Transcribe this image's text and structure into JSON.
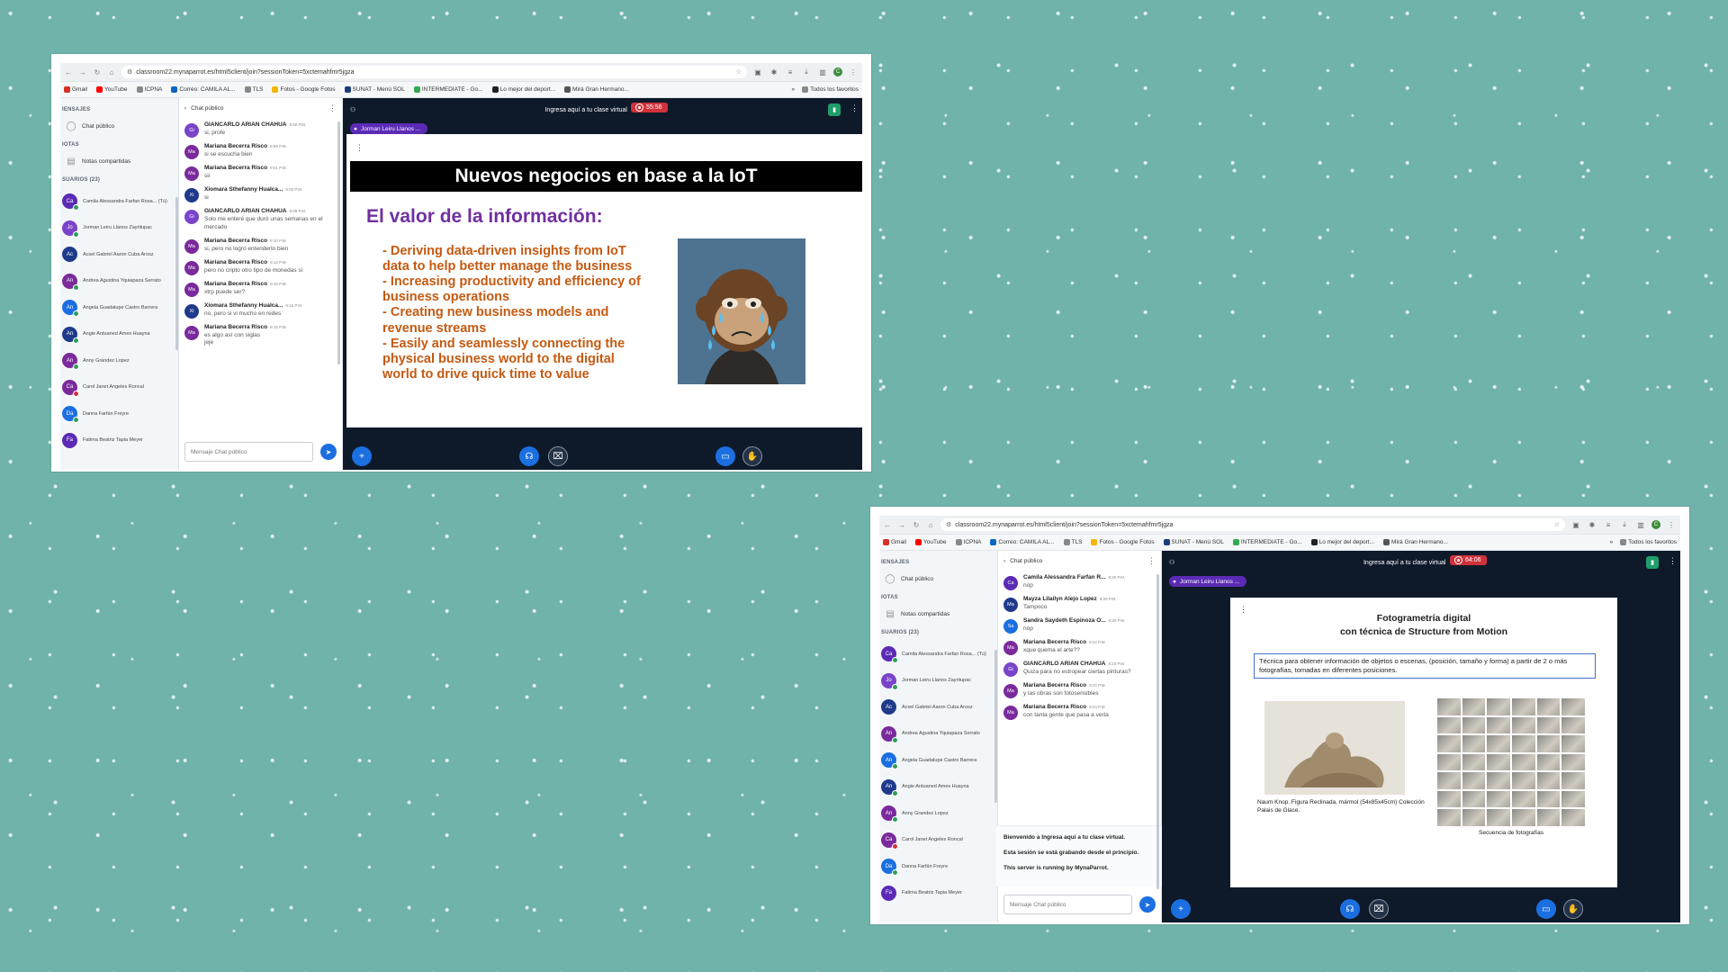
{
  "browser": {
    "url": "classroom22.mynaparrot.es/html5client/join?sessionToken=5xctemahfmr5jgza",
    "bookmarks": [
      "Gmail",
      "YouTube",
      "ICPNA",
      "Correo: CAMILA AL...",
      "TLS",
      "Fotos - Google Fotos",
      "SUNAT - Menú SOL",
      "INTERMEDIATE - Go...",
      "Lo mejor del deport...",
      "Mirá Gran Hermano..."
    ],
    "bookmarks_overflow": "»",
    "all_bookmarks": "Todos los favoritos",
    "profile_initial": "C"
  },
  "sidebar": {
    "messages_header": "IENSAJES",
    "public_chat": "Chat público",
    "notes_header": "IOTAS",
    "shared_notes": "Notas compartidas",
    "users_header": "SUARIOS (23)",
    "users": [
      {
        "initials": "Ca",
        "name": "Camila Alessandra Farfan Rosa... (Tú)",
        "color": "#5b2bb5",
        "status": "green"
      },
      {
        "initials": "Jo",
        "name": "Jorman Leiru Llanos Zayritupac",
        "color": "#7a44c9",
        "status": "green"
      },
      {
        "initials": "Ac",
        "name": "Acxel Gabriel Aaron Cuba Arosz",
        "color": "#1f3a8a",
        "status": ""
      },
      {
        "initials": "An",
        "name": "Andrea Agustina Yquiapaza Serrato",
        "color": "#7a2a9c",
        "status": "green"
      },
      {
        "initials": "An",
        "name": "Angela Guadalupe Castro Barrera",
        "color": "#1b6fe0",
        "status": "green"
      },
      {
        "initials": "An",
        "name": "Angie Antuaned Ames Huayna",
        "color": "#1f3a8a",
        "status": "green"
      },
      {
        "initials": "An",
        "name": "Anny Grandez Lopez",
        "color": "#7a2a9c",
        "status": "green"
      },
      {
        "initials": "Ca",
        "name": "Carol Janet Angeles Roncal",
        "color": "#7a2a9c",
        "status": "red"
      },
      {
        "initials": "Da",
        "name": "Danna Farfán Freyre",
        "color": "#1b6fe0",
        "status": "green"
      },
      {
        "initials": "Fa",
        "name": "Fatima Beatriz Tapia Meyer",
        "color": "#5b2bb5",
        "status": ""
      }
    ]
  },
  "chat": {
    "title": "Chat público",
    "placeholder": "Mensaje Chat público"
  },
  "window1": {
    "messages": [
      {
        "initials": "Gi",
        "color": "#7a44c9",
        "name": "GIANCARLO ARIAN CHAHUA",
        "time": "8:58 P.M.",
        "text": "si, profe"
      },
      {
        "initials": "Ma",
        "color": "#7a2a9c",
        "name": "Mariana Becerra Risco",
        "time": "8:59 P.M.",
        "text": "si se escucha bien"
      },
      {
        "initials": "Ma",
        "color": "#7a2a9c",
        "name": "Mariana Becerra Risco",
        "time": "9:01 P.M.",
        "text": "sii"
      },
      {
        "initials": "Xi",
        "color": "#1f3a8a",
        "name": "Xiomara Sthefanny Hualca...",
        "time": "9:02 P.M.",
        "text": "si"
      },
      {
        "initials": "Gi",
        "color": "#7a44c9",
        "name": "GIANCARLO ARIAN CHAHUA",
        "time": "9:09 P.M.",
        "text": "Solo me enteré que duró unas semanas en el mercado"
      },
      {
        "initials": "Ma",
        "color": "#7a2a9c",
        "name": "Mariana Becerra Risco",
        "time": "9:10 P.M.",
        "text": "si, pero no logro entenderlo bien"
      },
      {
        "initials": "Ma",
        "color": "#7a2a9c",
        "name": "Mariana Becerra Risco",
        "time": "9:14 P.M.",
        "text": "pero no cripto otro tipo de monedas si"
      },
      {
        "initials": "Ma",
        "color": "#7a2a9c",
        "name": "Mariana Becerra Risco",
        "time": "9:15 P.M.",
        "text": "xtrp puede ser?"
      },
      {
        "initials": "Xi",
        "color": "#1f3a8a",
        "name": "Xiomara Sthefanny Hualca...",
        "time": "9:15 P.M.",
        "text": "no, pero si vi mucho en redes"
      },
      {
        "initials": "Ma",
        "color": "#7a2a9c",
        "name": "Mariana Becerra Risco",
        "time": "9:15 P.M.",
        "text": "es algo así con siglas\njeje"
      }
    ],
    "stage_title": "Ingresa aquí a tu clase virtual",
    "timer": "55:56",
    "presenter": "Jorman Leiru Llanos ...",
    "slide": {
      "title": "Nuevos negocios en base a la IoT",
      "subtitle": "El valor de la información:",
      "bullets": [
        "- Deriving data-driven insights from IoT data to help better manage the business",
        "- Increasing productivity and efficiency of business operations",
        "- Creating new business models and revenue streams",
        "- Easily and seamlessly connecting the physical business world to the digital world to drive quick time to value"
      ]
    }
  },
  "window2": {
    "messages": [
      {
        "initials": "Ca",
        "color": "#5b2bb5",
        "name": "Camila Alessandra Farfan R...",
        "time": "9:20 P.M.",
        "text": "nop"
      },
      {
        "initials": "Ma",
        "color": "#1f3a8a",
        "name": "Mayza Lilailyn Alejo Lopez",
        "time": "9:20 P.M.",
        "text": "Tampoco"
      },
      {
        "initials": "Sa",
        "color": "#1b6fe0",
        "name": "Sandra Saydeth Espinoza O...",
        "time": "9:20 P.M.",
        "text": "nop"
      },
      {
        "initials": "Ma",
        "color": "#7a2a9c",
        "name": "Mariana Becerra Risco",
        "time": "9:22 P.M.",
        "text": "xque quema el arte??"
      },
      {
        "initials": "Gi",
        "color": "#7a44c9",
        "name": "GIANCARLO ARIAN CHAHUA",
        "time": "9:23 P.M.",
        "text": "Quiza para no estropear ciertas pinturas?"
      },
      {
        "initials": "Ma",
        "color": "#7a2a9c",
        "name": "Mariana Becerra Risco",
        "time": "9:23 P.M.",
        "text": "y las obras son fotosensibles"
      },
      {
        "initials": "Ma",
        "color": "#7a2a9c",
        "name": "Mariana Becerra Risco",
        "time": "9:24 P.M.",
        "text": "con tanta gente que pasa a verla"
      }
    ],
    "system": [
      "Bienvenido a Ingresa aquí a tu clase virtual.",
      "Esta sesión se está grabando desde el principio.",
      "This server is running by MynaParrot."
    ],
    "stage_title": "Ingresa aquí a tu clase virtual",
    "timer": "64:06",
    "presenter": "Jorman Leiru Llanos ...",
    "slide": {
      "title_line1": "Fotogrametría digital",
      "title_line2": "con técnica de Structure from Motion",
      "box": "Técnica para obtener información de objetos o escenas, (posición, tamaño y forma) a partir de 2 o más fotografías, tomadas en diferentes posiciones.",
      "caption1": "Naum Knop. Figura Reclinada, mármol (54x85x45cm) Colección Palais de Glace.",
      "caption2": "Secuencia de fotografías"
    }
  }
}
